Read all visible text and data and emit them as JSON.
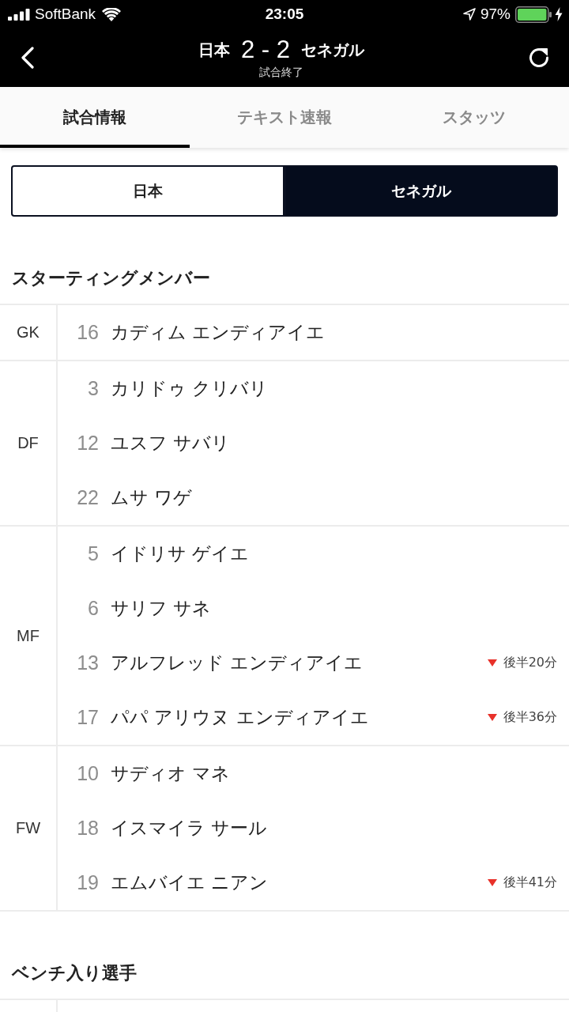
{
  "status_bar": {
    "carrier": "SoftBank",
    "time": "23:05",
    "battery": "97%"
  },
  "header": {
    "home_team": "日本",
    "score": "2 - 2",
    "away_team": "セネガル",
    "status": "試合終了"
  },
  "tabs": [
    {
      "label": "試合情報",
      "selected": true
    },
    {
      "label": "テキスト速報",
      "selected": false
    },
    {
      "label": "スタッツ",
      "selected": false
    }
  ],
  "team_toggle": [
    {
      "label": "日本",
      "selected": false
    },
    {
      "label": "セネガル",
      "selected": true
    }
  ],
  "sections": [
    {
      "title": "スターティングメンバー",
      "groups": [
        {
          "position": "GK",
          "players": [
            {
              "number": "16",
              "name": "カディム エンディアイエ"
            }
          ]
        },
        {
          "position": "DF",
          "players": [
            {
              "number": "3",
              "name": "カリドゥ クリバリ"
            },
            {
              "number": "12",
              "name": "ユスフ サバリ"
            },
            {
              "number": "22",
              "name": "ムサ ワゲ"
            }
          ]
        },
        {
          "position": "MF",
          "players": [
            {
              "number": "5",
              "name": "イドリサ ゲイエ"
            },
            {
              "number": "6",
              "name": "サリフ サネ"
            },
            {
              "number": "13",
              "name": "アルフレッド エンディアイエ",
              "substitution": {
                "kind": "out",
                "time": "後半20分"
              }
            },
            {
              "number": "17",
              "name": "パパ アリウヌ エンディアイエ",
              "substitution": {
                "kind": "out",
                "time": "後半36分"
              }
            }
          ]
        },
        {
          "position": "FW",
          "players": [
            {
              "number": "10",
              "name": "サディオ マネ"
            },
            {
              "number": "18",
              "name": "イスマイラ サール"
            },
            {
              "number": "19",
              "name": "エムバイエ ニアン",
              "substitution": {
                "kind": "out",
                "time": "後半41分"
              }
            }
          ]
        }
      ]
    },
    {
      "title": "ベンチ入り選手"
    }
  ]
}
